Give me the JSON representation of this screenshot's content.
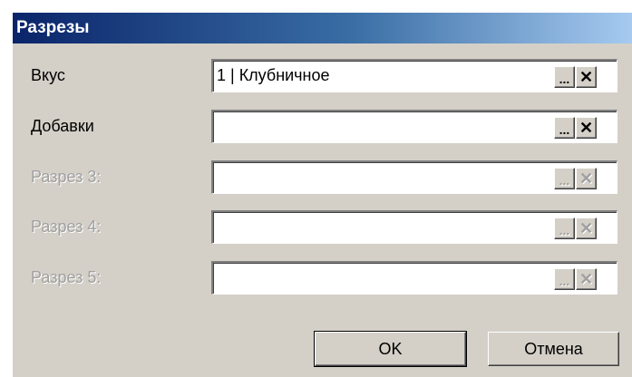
{
  "window": {
    "title": "Разрезы"
  },
  "rows": [
    {
      "label": "Вкус",
      "value": "1 | Клубничное",
      "ellipsis": "...",
      "clear": "✕",
      "disabled": false
    },
    {
      "label": "Добавки",
      "value": "",
      "ellipsis": "...",
      "clear": "✕",
      "disabled": false
    },
    {
      "label": "Разрез 3:",
      "value": "",
      "ellipsis": "...",
      "clear": "✕",
      "disabled": true
    },
    {
      "label": "Разрез 4:",
      "value": "",
      "ellipsis": "...",
      "clear": "✕",
      "disabled": true
    },
    {
      "label": "Разрез 5:",
      "value": "",
      "ellipsis": "...",
      "clear": "✕",
      "disabled": true
    }
  ],
  "buttons": {
    "ok": "OK",
    "cancel": "Отмена"
  }
}
